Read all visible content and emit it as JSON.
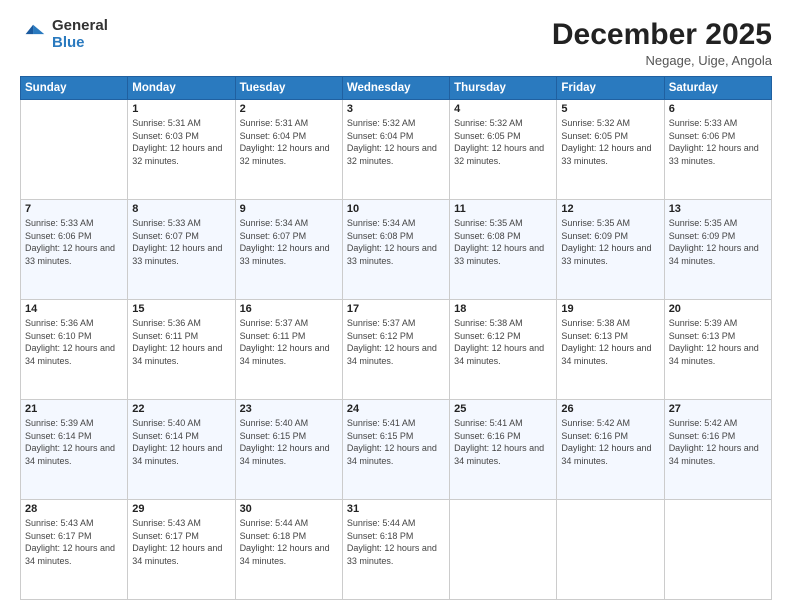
{
  "logo": {
    "general": "General",
    "blue": "Blue"
  },
  "header": {
    "month": "December 2025",
    "location": "Negage, Uige, Angola"
  },
  "days": [
    "Sunday",
    "Monday",
    "Tuesday",
    "Wednesday",
    "Thursday",
    "Friday",
    "Saturday"
  ],
  "weeks": [
    [
      {
        "day": "",
        "sunrise": "",
        "sunset": "",
        "daylight": ""
      },
      {
        "day": "1",
        "sunrise": "Sunrise: 5:31 AM",
        "sunset": "Sunset: 6:03 PM",
        "daylight": "Daylight: 12 hours and 32 minutes."
      },
      {
        "day": "2",
        "sunrise": "Sunrise: 5:31 AM",
        "sunset": "Sunset: 6:04 PM",
        "daylight": "Daylight: 12 hours and 32 minutes."
      },
      {
        "day": "3",
        "sunrise": "Sunrise: 5:32 AM",
        "sunset": "Sunset: 6:04 PM",
        "daylight": "Daylight: 12 hours and 32 minutes."
      },
      {
        "day": "4",
        "sunrise": "Sunrise: 5:32 AM",
        "sunset": "Sunset: 6:05 PM",
        "daylight": "Daylight: 12 hours and 32 minutes."
      },
      {
        "day": "5",
        "sunrise": "Sunrise: 5:32 AM",
        "sunset": "Sunset: 6:05 PM",
        "daylight": "Daylight: 12 hours and 33 minutes."
      },
      {
        "day": "6",
        "sunrise": "Sunrise: 5:33 AM",
        "sunset": "Sunset: 6:06 PM",
        "daylight": "Daylight: 12 hours and 33 minutes."
      }
    ],
    [
      {
        "day": "7",
        "sunrise": "Sunrise: 5:33 AM",
        "sunset": "Sunset: 6:06 PM",
        "daylight": "Daylight: 12 hours and 33 minutes."
      },
      {
        "day": "8",
        "sunrise": "Sunrise: 5:33 AM",
        "sunset": "Sunset: 6:07 PM",
        "daylight": "Daylight: 12 hours and 33 minutes."
      },
      {
        "day": "9",
        "sunrise": "Sunrise: 5:34 AM",
        "sunset": "Sunset: 6:07 PM",
        "daylight": "Daylight: 12 hours and 33 minutes."
      },
      {
        "day": "10",
        "sunrise": "Sunrise: 5:34 AM",
        "sunset": "Sunset: 6:08 PM",
        "daylight": "Daylight: 12 hours and 33 minutes."
      },
      {
        "day": "11",
        "sunrise": "Sunrise: 5:35 AM",
        "sunset": "Sunset: 6:08 PM",
        "daylight": "Daylight: 12 hours and 33 minutes."
      },
      {
        "day": "12",
        "sunrise": "Sunrise: 5:35 AM",
        "sunset": "Sunset: 6:09 PM",
        "daylight": "Daylight: 12 hours and 33 minutes."
      },
      {
        "day": "13",
        "sunrise": "Sunrise: 5:35 AM",
        "sunset": "Sunset: 6:09 PM",
        "daylight": "Daylight: 12 hours and 34 minutes."
      }
    ],
    [
      {
        "day": "14",
        "sunrise": "Sunrise: 5:36 AM",
        "sunset": "Sunset: 6:10 PM",
        "daylight": "Daylight: 12 hours and 34 minutes."
      },
      {
        "day": "15",
        "sunrise": "Sunrise: 5:36 AM",
        "sunset": "Sunset: 6:11 PM",
        "daylight": "Daylight: 12 hours and 34 minutes."
      },
      {
        "day": "16",
        "sunrise": "Sunrise: 5:37 AM",
        "sunset": "Sunset: 6:11 PM",
        "daylight": "Daylight: 12 hours and 34 minutes."
      },
      {
        "day": "17",
        "sunrise": "Sunrise: 5:37 AM",
        "sunset": "Sunset: 6:12 PM",
        "daylight": "Daylight: 12 hours and 34 minutes."
      },
      {
        "day": "18",
        "sunrise": "Sunrise: 5:38 AM",
        "sunset": "Sunset: 6:12 PM",
        "daylight": "Daylight: 12 hours and 34 minutes."
      },
      {
        "day": "19",
        "sunrise": "Sunrise: 5:38 AM",
        "sunset": "Sunset: 6:13 PM",
        "daylight": "Daylight: 12 hours and 34 minutes."
      },
      {
        "day": "20",
        "sunrise": "Sunrise: 5:39 AM",
        "sunset": "Sunset: 6:13 PM",
        "daylight": "Daylight: 12 hours and 34 minutes."
      }
    ],
    [
      {
        "day": "21",
        "sunrise": "Sunrise: 5:39 AM",
        "sunset": "Sunset: 6:14 PM",
        "daylight": "Daylight: 12 hours and 34 minutes."
      },
      {
        "day": "22",
        "sunrise": "Sunrise: 5:40 AM",
        "sunset": "Sunset: 6:14 PM",
        "daylight": "Daylight: 12 hours and 34 minutes."
      },
      {
        "day": "23",
        "sunrise": "Sunrise: 5:40 AM",
        "sunset": "Sunset: 6:15 PM",
        "daylight": "Daylight: 12 hours and 34 minutes."
      },
      {
        "day": "24",
        "sunrise": "Sunrise: 5:41 AM",
        "sunset": "Sunset: 6:15 PM",
        "daylight": "Daylight: 12 hours and 34 minutes."
      },
      {
        "day": "25",
        "sunrise": "Sunrise: 5:41 AM",
        "sunset": "Sunset: 6:16 PM",
        "daylight": "Daylight: 12 hours and 34 minutes."
      },
      {
        "day": "26",
        "sunrise": "Sunrise: 5:42 AM",
        "sunset": "Sunset: 6:16 PM",
        "daylight": "Daylight: 12 hours and 34 minutes."
      },
      {
        "day": "27",
        "sunrise": "Sunrise: 5:42 AM",
        "sunset": "Sunset: 6:16 PM",
        "daylight": "Daylight: 12 hours and 34 minutes."
      }
    ],
    [
      {
        "day": "28",
        "sunrise": "Sunrise: 5:43 AM",
        "sunset": "Sunset: 6:17 PM",
        "daylight": "Daylight: 12 hours and 34 minutes."
      },
      {
        "day": "29",
        "sunrise": "Sunrise: 5:43 AM",
        "sunset": "Sunset: 6:17 PM",
        "daylight": "Daylight: 12 hours and 34 minutes."
      },
      {
        "day": "30",
        "sunrise": "Sunrise: 5:44 AM",
        "sunset": "Sunset: 6:18 PM",
        "daylight": "Daylight: 12 hours and 34 minutes."
      },
      {
        "day": "31",
        "sunrise": "Sunrise: 5:44 AM",
        "sunset": "Sunset: 6:18 PM",
        "daylight": "Daylight: 12 hours and 33 minutes."
      },
      {
        "day": "",
        "sunrise": "",
        "sunset": "",
        "daylight": ""
      },
      {
        "day": "",
        "sunrise": "",
        "sunset": "",
        "daylight": ""
      },
      {
        "day": "",
        "sunrise": "",
        "sunset": "",
        "daylight": ""
      }
    ]
  ]
}
